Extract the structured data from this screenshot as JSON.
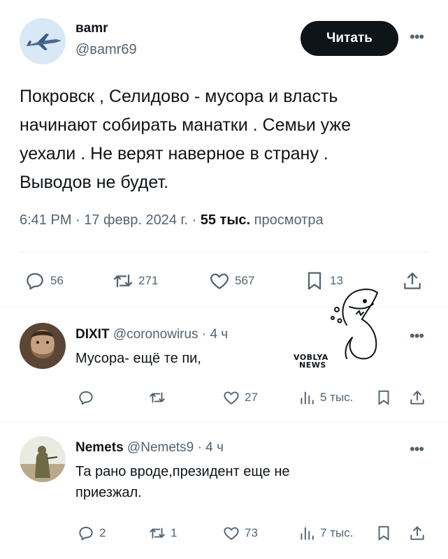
{
  "main_tweet": {
    "name": "вamr",
    "handle": "@вamr69",
    "follow_label": "Читать",
    "text_lines": [
      "Покровск , Селидово  - мусора и власть",
      "начинают собирать манатки . Семьи уже",
      "уехали . Не верят наверное в страну .",
      "Выводов не будет."
    ],
    "time": "6:41 PM · 17 февр. 2024 г. · ",
    "views_count": "55 тыс.",
    "views_label": " просмотра",
    "replies": "56",
    "retweets": "271",
    "likes": "567",
    "bookmarks": "13"
  },
  "replies": [
    {
      "name": "DIXIT",
      "handle": " @coronowirus · 4 ч",
      "text_lines": [
        "Мусора- ещё те пи,"
      ],
      "replies": "",
      "retweets": "",
      "likes": "27",
      "views": "5 тыс."
    },
    {
      "name": "Nemets",
      "handle": " @Nemets9 · 4 ч",
      "text_lines": [
        "Та рано вроде,президент еще не",
        "приезжал."
      ],
      "replies": "2",
      "retweets": "1",
      "likes": "73",
      "views": "7 тыс."
    }
  ],
  "watermark": {
    "line1": "VOBLYA",
    "line2": "NEWS"
  },
  "icons": [
    "more-icon",
    "reply-icon",
    "retweet-icon",
    "like-icon",
    "bookmark-icon",
    "share-icon",
    "views-icon"
  ],
  "colors": {
    "text": "#0f1419",
    "secondary": "#536471",
    "divider": "#eff3f4",
    "button": "#0f1419"
  }
}
